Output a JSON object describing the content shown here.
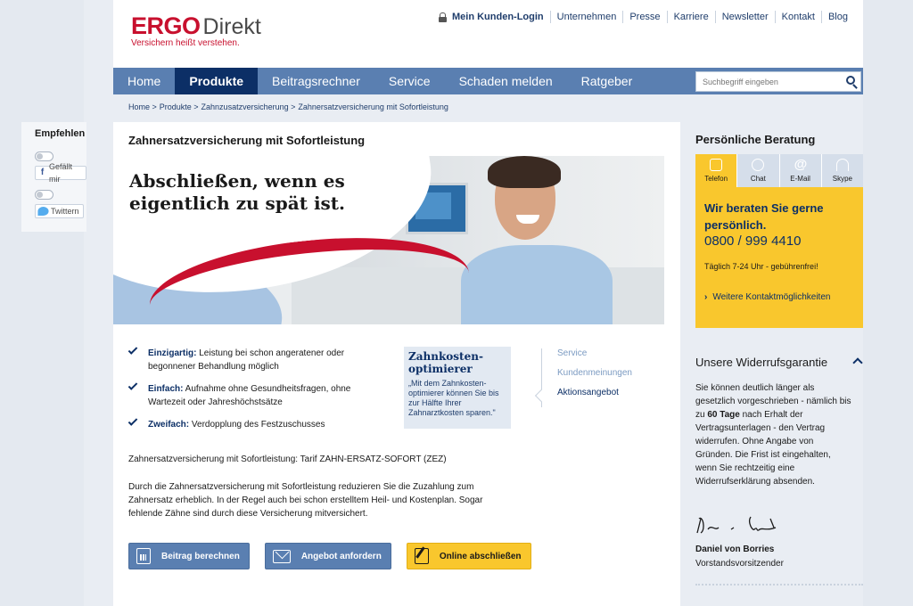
{
  "logo": {
    "brand": "ERGO",
    "sub": "Direkt",
    "tagline": "Versichern heißt verstehen."
  },
  "topnav": [
    "Mein Kunden-Login",
    "Unternehmen",
    "Presse",
    "Karriere",
    "Newsletter",
    "Kontakt",
    "Blog"
  ],
  "mainnav": [
    "Home",
    "Produkte",
    "Beitragsrechner",
    "Service",
    "Schaden melden",
    "Ratgeber"
  ],
  "search": {
    "placeholder": "Suchbegriff eingeben"
  },
  "breadcrumb": [
    "Home >",
    "Produkte >",
    "Zahnzusatzversicherung >",
    "Zahnersatzversicherung mit Sofortleistung"
  ],
  "share": {
    "title": "Empfehlen",
    "facebook": "Gefällt mir",
    "twitter": "Twittern"
  },
  "content": {
    "title": "Zahnersatzversicherung mit Sofortleistung",
    "hero_text": "Abschließen, wenn es eigentlich zu spät ist.",
    "checks": [
      {
        "bold": "Einzigartig:",
        "text": " Leistung bei schon angeratener oder begonnener Behandlung möglich"
      },
      {
        "bold": "Einfach:",
        "text": " Aufnahme ohne Gesundheitsfragen, ohne Wartezeit oder Jahreshöchstsätze"
      },
      {
        "bold": "Zweifach:",
        "text": " Verdopplung des Festzuschusses"
      }
    ],
    "optimizer": {
      "title": "Zahnkosten-optimierer",
      "quote": "„Mit dem Zahnkosten-optimierer können Sie bis zur Hälfte Ihrer Zahnarztkosten sparen.\""
    },
    "tabs": [
      "Service",
      "Kundenmeinungen",
      "Aktionsangebot"
    ],
    "tarif": "Zahnersatzversicherung mit Sofortleistung: Tarif ZAHN-ERSATZ-SOFORT (ZEZ)",
    "description": "Durch die Zahnersatzversicherung mit Sofortleistung  reduzieren Sie die Zuzahlung zum Zahnersatz erheblich. In der Regel auch bei schon erstelltem Heil- und Kostenplan. Sogar fehlende Zähne sind durch diese Versicherung mitversichert.",
    "buttons": {
      "calc": "Beitrag berechnen",
      "offer": "Angebot anfordern",
      "online": "Online abschließen"
    }
  },
  "aside": {
    "title": "Persönliche Beratung",
    "tabs": [
      "Telefon",
      "Chat",
      "E-Mail",
      "Skype"
    ],
    "lead": "Wir beraten Sie gerne persönlich.",
    "phone": "0800 / 999 4410",
    "hours": "Täglich 7-24 Uhr - gebührenfrei!",
    "more": "Weitere Kontaktmöglichkeiten",
    "widerruf_title": "Unsere Widerrufsgarantie",
    "widerruf_text_a": "Sie können deutlich länger als gesetzlich vorgeschrieben - nämlich bis zu ",
    "widerruf_text_b": "60 Tage",
    "widerruf_text_c": " nach Erhalt der Vertragsunterlagen - den Vertrag widerrufen. Ohne Angabe von Gründen. Die Frist ist eingehalten, wenn Sie rechtzeitig eine Widerrufserklärung absenden.",
    "sig_name": "Daniel von Borries",
    "sig_role": "Vorstandsvorsitzender"
  }
}
